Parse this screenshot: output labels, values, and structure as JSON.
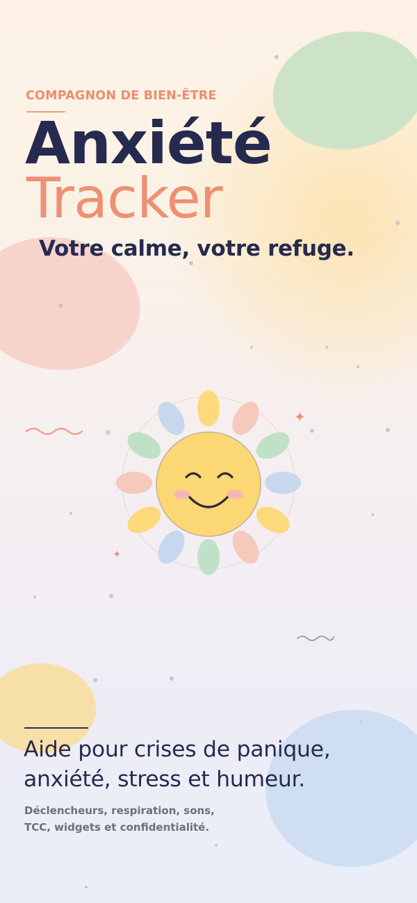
{
  "eyebrow": "COMPAGNON DE BIEN-ÊTRE",
  "title": {
    "line1": "Anxiété",
    "line2": "Tracker"
  },
  "tagline": "Votre calme, votre refuge.",
  "headline": {
    "line1": "Aide pour crises de panique,",
    "line2": "anxiété, stress et humeur."
  },
  "features": {
    "line1": "Déclencheurs, respiration, sons,",
    "line2": "TCC, widgets et confidentialité."
  },
  "illustration": {
    "icon": "smiling-sun-icon",
    "petal_colors": [
      "#fbd97b",
      "#f6c9bd",
      "#bfe1c8",
      "#c7d8ee"
    ],
    "face_color": "#fcd874"
  },
  "colors": {
    "accent": "#ef8f74",
    "text_dark": "#262a4f",
    "text_muted": "#6c6e80"
  }
}
